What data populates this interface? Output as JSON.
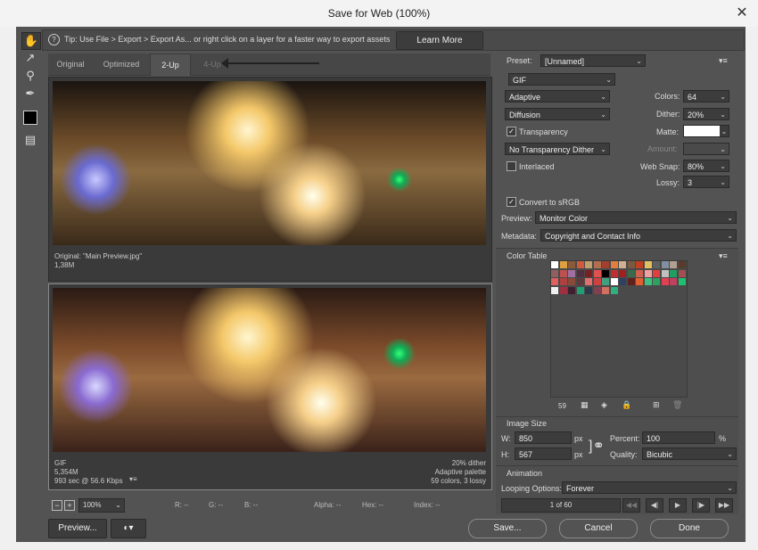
{
  "window": {
    "title": "Save for Web (100%)",
    "close": "✕"
  },
  "tip": {
    "icon": "?",
    "text": "Tip: Use File > Export > Export As... or right click on a layer for a faster way to export assets",
    "learn_more": "Learn More"
  },
  "tools": [
    "hand-icon",
    "slice-select-icon",
    "zoom-icon",
    "eyedropper-icon",
    "color-swatch",
    "toggle-slices-icon"
  ],
  "tabs": [
    "Original",
    "Optimized",
    "2-Up",
    "4-Up"
  ],
  "original_preview": {
    "line1": "Original: \"Main Preview.jpg\"",
    "line2": "1,38M"
  },
  "optimized_preview": {
    "left1": "GIF",
    "left2": "5,354M",
    "left3": "993 sec @ 56.6 Kbps",
    "right1": "20% dither",
    "right2": "Adaptive palette",
    "right3": "59 colors, 3 lossy"
  },
  "status": {
    "zoom": "100%",
    "r": "R: --",
    "g": "G: --",
    "b": "B: --",
    "alpha": "Alpha: --",
    "hex": "Hex: --",
    "index": "Index: --"
  },
  "buttons": {
    "preview": "Preview...",
    "save": "Save...",
    "cancel": "Cancel",
    "done": "Done"
  },
  "settings": {
    "preset_label": "Preset:",
    "preset_value": "[Unnamed]",
    "format": "GIF",
    "reduction": "Adaptive",
    "dither_algo": "Diffusion",
    "transparency": "Transparency",
    "trans_dither": "No Transparency Dither",
    "interlaced": "Interlaced",
    "colors_label": "Colors:",
    "colors_value": "64",
    "dither_label": "Dither:",
    "dither_value": "20%",
    "matte_label": "Matte:",
    "amount_label": "Amount:",
    "websnap_label": "Web Snap:",
    "websnap_value": "80%",
    "lossy_label": "Lossy:",
    "lossy_value": "3",
    "convert_srgb": "Convert to sRGB",
    "preview_label": "Preview:",
    "preview_value": "Monitor Color",
    "metadata_label": "Metadata:",
    "metadata_value": "Copyright and Contact Info"
  },
  "color_table": {
    "title": "Color Table",
    "count": "59",
    "swatches": [
      "#ffffff",
      "#e0a040",
      "#8a5a3a",
      "#d05a3a",
      "#c0a070",
      "#b07050",
      "#a04030",
      "#e08040",
      "#d0b090",
      "#7a5a40",
      "#c04020",
      "#e0c060",
      "#606060",
      "#8090a0",
      "#b0a090",
      "#5a3a2a",
      "#906060",
      "#c05050",
      "#a070a0",
      "#503040",
      "#7a2020",
      "#e05050",
      "#000000",
      "#c03030",
      "#a02020",
      "#3a6a4a",
      "#d06050",
      "#f0a0a0",
      "#e04040",
      "#c0c0c0",
      "#20a060",
      "#a05050",
      "#e06060",
      "#b04040",
      "#8a4a3a",
      "#603a3a",
      "#e07070",
      "#d04040",
      "#40a080",
      "#ffffff",
      "#304060",
      "#602020",
      "#e06030",
      "#40c080",
      "#30a060",
      "#e04050",
      "#c04060",
      "#20c070",
      "#f0f0f0",
      "#a03040",
      "#402030",
      "#20a070",
      "#2a3a4a",
      "#804050",
      "#d07060",
      "#30b080"
    ]
  },
  "image_size": {
    "title": "Image Size",
    "w_label": "W:",
    "w_value": "850",
    "w_unit": "px",
    "h_label": "H:",
    "h_value": "567",
    "h_unit": "px",
    "percent_label": "Percent:",
    "percent_value": "100",
    "percent_unit": "%",
    "quality_label": "Quality:",
    "quality_value": "Bicubic"
  },
  "animation": {
    "title": "Animation",
    "looping_label": "Looping Options:",
    "looping_value": "Forever",
    "frame": "1 of 60"
  }
}
